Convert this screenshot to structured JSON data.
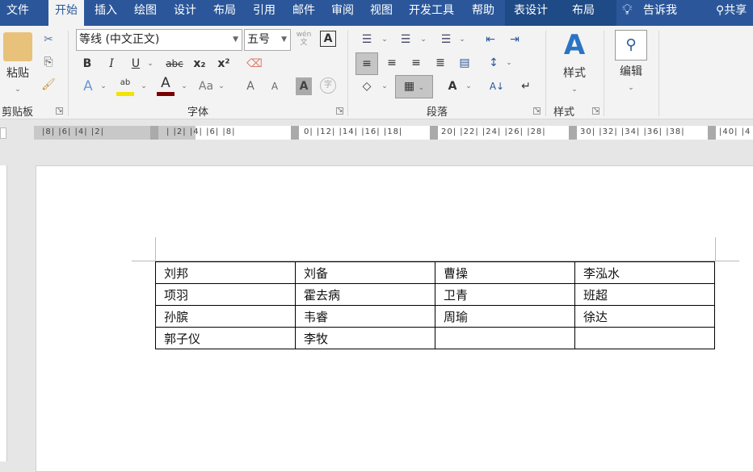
{
  "tabs": [
    "文件",
    "开始",
    "插入",
    "绘图",
    "设计",
    "布局",
    "引用",
    "邮件",
    "审阅",
    "视图",
    "开发工具",
    "帮助",
    "表设计",
    "布局"
  ],
  "selected_tab": "开始",
  "tell_me": "告诉我",
  "share": "共享",
  "clipboard": {
    "paste": "粘贴",
    "label": "剪贴板"
  },
  "font": {
    "name": "等线 (中文正文)",
    "size": "五号",
    "label": "字体",
    "bold": "B",
    "italic": "I",
    "underline": "U",
    "strike": "abc",
    "sub": "x₂",
    "sup": "x²",
    "grow": "A",
    "shrink": "A",
    "case": "Aa",
    "color_a": "A",
    "shade_a": "A",
    "phonetic": "wén\n文",
    "border_a": "A",
    "enclose": "字",
    "font_color": "#7b0000",
    "highlight_color": "#f4e200"
  },
  "paragraph": {
    "label": "段落"
  },
  "styles": {
    "button": "样式",
    "label": "样式"
  },
  "editing": {
    "button": "编辑"
  },
  "ruler": {
    "left": "|8| |6| |4| |2|",
    "main": "| |2| |4| |6| |8|",
    "s2": "0| |12| |14| |16| |18|",
    "s3": "20| |22| |24| |26| |28|",
    "s4": "30| |32| |34| |36| |38|",
    "s5": "|40| |4"
  },
  "table": [
    [
      "刘邦",
      "刘备",
      "曹操",
      "李泓水"
    ],
    [
      "项羽",
      "霍去病",
      "卫青",
      "班超"
    ],
    [
      "孙膑",
      "韦睿",
      "周瑜",
      "徐达"
    ],
    [
      "郭子仪",
      "李牧",
      "",
      ""
    ]
  ],
  "colors": {
    "accent": "#2b579a"
  }
}
